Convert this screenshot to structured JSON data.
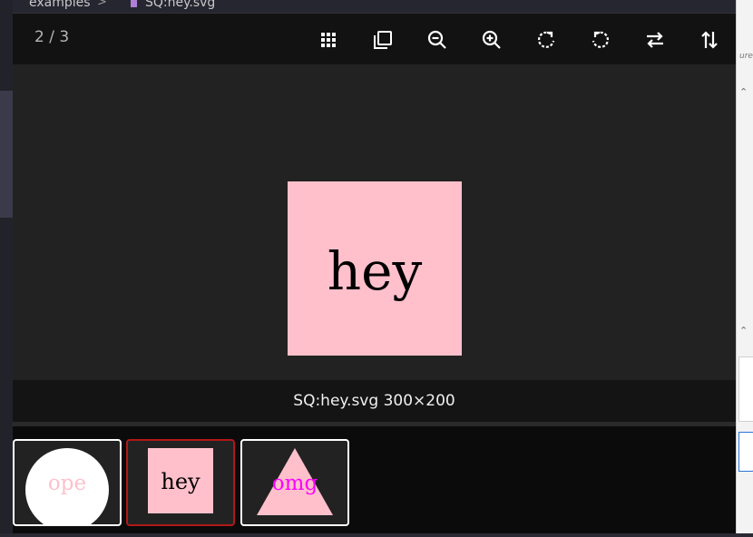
{
  "breadcrumb": {
    "folder": "examples",
    "separator": ">",
    "file": "SQ:hey.svg"
  },
  "side_panel": {
    "hint": "ures."
  },
  "viewer": {
    "counter": "2 / 3",
    "toolbar": [
      {
        "name": "grid-view-button",
        "icon": "grid-icon"
      },
      {
        "name": "copy-button",
        "icon": "copy-icon"
      },
      {
        "name": "zoom-out-button",
        "icon": "zoom-out-icon"
      },
      {
        "name": "zoom-in-button",
        "icon": "zoom-in-icon"
      },
      {
        "name": "rotate-right-button",
        "icon": "rotate-cw-icon"
      },
      {
        "name": "rotate-left-button",
        "icon": "rotate-ccw-icon"
      },
      {
        "name": "flip-horizontal-button",
        "icon": "flip-horizontal-icon"
      },
      {
        "name": "flip-vertical-button",
        "icon": "flip-vertical-icon"
      }
    ],
    "main_image_text": "hey",
    "caption": "SQ:hey.svg 300×200",
    "thumbnails": [
      {
        "text": "ope",
        "shape": "circle",
        "active": false
      },
      {
        "text": "hey",
        "shape": "square",
        "active": true
      },
      {
        "text": "omg",
        "shape": "triangle",
        "active": false
      }
    ]
  },
  "colors": {
    "image_fill": "#ffc0cb",
    "active_thumb_border": "#b11818",
    "triangle_text": "#ff00ff"
  }
}
